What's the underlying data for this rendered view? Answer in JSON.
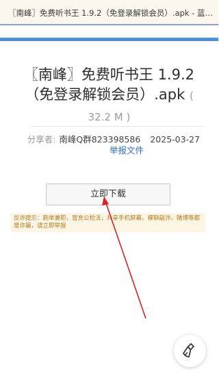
{
  "browser": {
    "tab_title": "〖南峰〗免费听书王 1.9.2（免登录解锁会员）.apk - 蓝奏云..."
  },
  "file": {
    "name": "〖南峰〗免费听书王 1.9.2（免登录解锁会员）.apk",
    "size": "( 32.2 M )"
  },
  "share": {
    "label": "分享者:",
    "user": "南峰Q群823398586",
    "date": "2025-03-27",
    "report_label": "举报文件"
  },
  "download": {
    "label": "立即下载"
  },
  "warning": {
    "text": "反诈提示：刷单兼职，冒充公检法，共享手机屏幕，裸聊敲诈，赌博等都是诈骗，请立即举报"
  },
  "icons": {
    "fab": "broom-icon",
    "annotation": "arrow-annotation"
  },
  "colors": {
    "accent": "#4a8fe0",
    "link": "#2a6fd6",
    "warning_bg": "#fdf5e3",
    "warning_text": "#b07a22",
    "arrow": "#e02020"
  }
}
